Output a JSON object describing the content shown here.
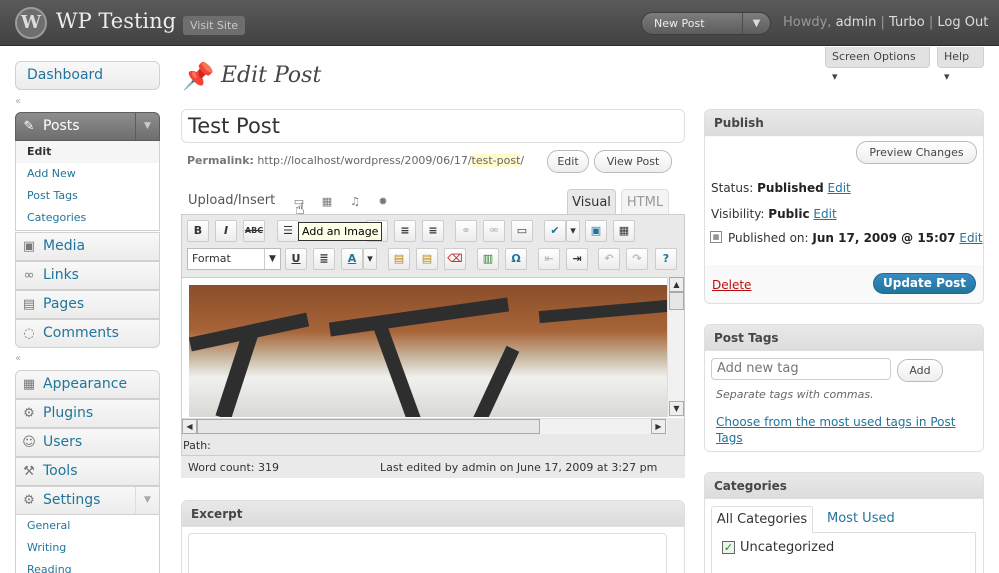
{
  "header": {
    "site_title": "WP Testing",
    "visit_site": "Visit Site",
    "new_post": "New Post",
    "howdy": "Howdy,",
    "user": "admin",
    "turbo": "Turbo",
    "logout": "Log Out"
  },
  "screen_meta": {
    "screen_options": "Screen Options ▾",
    "help": "Help ▾"
  },
  "menu": {
    "dashboard": "Dashboard",
    "posts": "Posts",
    "posts_sub": [
      "Edit",
      "Add New",
      "Post Tags",
      "Categories"
    ],
    "media": "Media",
    "links": "Links",
    "pages": "Pages",
    "comments": "Comments",
    "appearance": "Appearance",
    "plugins": "Plugins",
    "users": "Users",
    "tools": "Tools",
    "settings": "Settings",
    "settings_sub": [
      "General",
      "Writing",
      "Reading"
    ]
  },
  "page": {
    "title": "Edit Post"
  },
  "post": {
    "title": "Test Post",
    "permalink_label": "Permalink:",
    "permalink_base": "http://localhost/wordpress/2009/06/17/",
    "permalink_slug": "test-post",
    "permalink_tail": "/",
    "edit_btn": "Edit",
    "view_btn": "View Post"
  },
  "editor": {
    "upload_insert": "Upload/Insert",
    "tab_visual": "Visual",
    "tab_html": "HTML",
    "format": "Format",
    "tooltip": "Add an Image",
    "path_label": "Path:",
    "word_count": "Word count: 319",
    "last_edited": "Last edited by admin on June 17, 2009 at 3:27 pm"
  },
  "excerpt": {
    "title": "Excerpt"
  },
  "publish": {
    "title": "Publish",
    "preview": "Preview Changes",
    "status_label": "Status:",
    "status_value": "Published",
    "visibility_label": "Visibility:",
    "visibility_value": "Public",
    "published_label": "Published on:",
    "published_value": "Jun 17, 2009 @ 15:07",
    "edit": "Edit",
    "delete": "Delete",
    "update": "Update Post"
  },
  "tags": {
    "title": "Post Tags",
    "placeholder": "Add new tag",
    "add": "Add",
    "hint": "Separate tags with commas.",
    "choose": "Choose from the most used tags in Post Tags"
  },
  "categories": {
    "title": "Categories",
    "tab_all": "All Categories",
    "tab_used": "Most Used",
    "item": "Uncategorized"
  },
  "colors": {
    "link": "#21759b",
    "header_bg": "#464646",
    "update_button": "#21759b",
    "delete_link": "#bc0b0b"
  }
}
